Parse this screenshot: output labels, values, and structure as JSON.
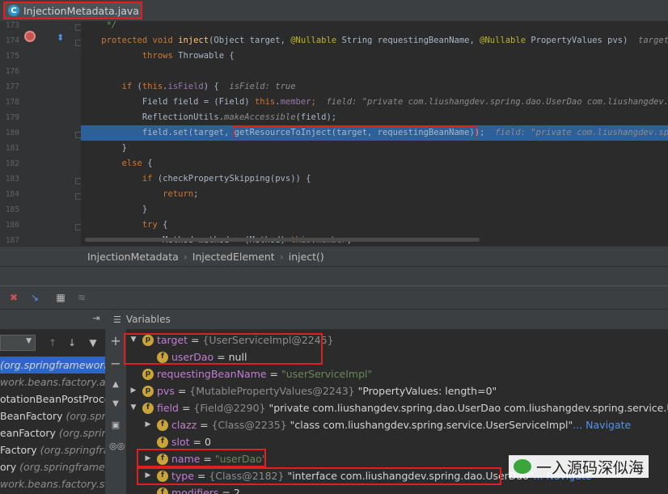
{
  "tab": {
    "label": "InjectionMetadata.java",
    "icon": "class-c-icon"
  },
  "editor": {
    "lines": [
      {
        "num": "173",
        "parts": [
          {
            "t": "     */",
            "c": "cm"
          }
        ]
      },
      {
        "num": "174",
        "parts": [
          {
            "t": "    ",
            "c": ""
          },
          {
            "t": "protected void ",
            "c": "kw"
          },
          {
            "t": "inject",
            "c": "mth"
          },
          {
            "t": "(Object target, ",
            "c": ""
          },
          {
            "t": "@Nullable ",
            "c": "an"
          },
          {
            "t": "String requestingBeanName, ",
            "c": ""
          },
          {
            "t": "@Nullable ",
            "c": "an"
          },
          {
            "t": "PropertyValues pvs)  ",
            "c": ""
          },
          {
            "t": "target: ",
            "c": "hint"
          }
        ]
      },
      {
        "num": "175",
        "parts": [
          {
            "t": "            ",
            "c": ""
          },
          {
            "t": "throws ",
            "c": "kw"
          },
          {
            "t": "Throwable {",
            "c": ""
          }
        ]
      },
      {
        "num": "176",
        "parts": []
      },
      {
        "num": "177",
        "parts": [
          {
            "t": "        ",
            "c": ""
          },
          {
            "t": "if ",
            "c": "kw"
          },
          {
            "t": "(",
            "c": ""
          },
          {
            "t": "this",
            "c": "kw"
          },
          {
            "t": ".",
            "c": ""
          },
          {
            "t": "isField",
            "c": "fld"
          },
          {
            "t": ") {  ",
            "c": ""
          },
          {
            "t": "isField: true",
            "c": "hint"
          }
        ]
      },
      {
        "num": "178",
        "parts": [
          {
            "t": "            Field field = (Field) ",
            "c": ""
          },
          {
            "t": "this",
            "c": "kw"
          },
          {
            "t": ".",
            "c": ""
          },
          {
            "t": "member",
            "c": "fld"
          },
          {
            "t": ";  ",
            "c": "kw"
          },
          {
            "t": "field: \"private com.liushangdev.spring.dao.UserDao com.liushangdev.s",
            "c": "hint"
          }
        ]
      },
      {
        "num": "179",
        "parts": [
          {
            "t": "            ReflectionUtils.",
            "c": ""
          },
          {
            "t": "makeAccessible",
            "c": "hint"
          },
          {
            "t": "(field);",
            "c": ""
          }
        ]
      },
      {
        "num": "180",
        "parts": [
          {
            "t": "            field.set(target, ",
            "c": ""
          },
          {
            "t": "getResourceToInject(target, requestingBeanName)",
            "c": "box"
          },
          {
            "t": ");  ",
            "c": ""
          },
          {
            "t": "field: \"private com.liushangdev.spr",
            "c": "hint"
          }
        ]
      },
      {
        "num": "181",
        "parts": [
          {
            "t": "        }",
            "c": ""
          }
        ]
      },
      {
        "num": "182",
        "parts": [
          {
            "t": "        ",
            "c": ""
          },
          {
            "t": "else ",
            "c": "kw"
          },
          {
            "t": "{",
            "c": ""
          }
        ]
      },
      {
        "num": "183",
        "parts": [
          {
            "t": "            ",
            "c": ""
          },
          {
            "t": "if ",
            "c": "kw"
          },
          {
            "t": "(checkPropertySkipping(pvs)) {",
            "c": ""
          }
        ]
      },
      {
        "num": "184",
        "parts": [
          {
            "t": "                ",
            "c": ""
          },
          {
            "t": "return",
            "c": "kw"
          },
          {
            "t": ";",
            "c": ""
          }
        ]
      },
      {
        "num": "185",
        "parts": [
          {
            "t": "            }",
            "c": ""
          }
        ]
      },
      {
        "num": "186",
        "parts": [
          {
            "t": "            ",
            "c": ""
          },
          {
            "t": "try ",
            "c": "kw"
          },
          {
            "t": "{",
            "c": ""
          }
        ]
      },
      {
        "num": "187",
        "parts": [
          {
            "t": "                Method method = (Method) ",
            "c": ""
          },
          {
            "t": "this",
            "c": "kw"
          },
          {
            "t": ".",
            "c": ""
          },
          {
            "t": "member",
            "c": "fld"
          },
          {
            "t": ";",
            "c": ""
          }
        ]
      }
    ],
    "highlight_line": "180"
  },
  "breadcrumb": [
    "InjectionMetadata",
    "InjectedElement",
    "inject()"
  ],
  "variables_title": "Variables",
  "frames": [
    {
      "main": "",
      "loc": "(org.springframework"
    },
    {
      "main": "",
      "loc": "work.beans.factory.ann"
    },
    {
      "main": "otationBeanPostProces",
      "loc": ""
    },
    {
      "main": "BeanFactory ",
      "loc": "(org.spring"
    },
    {
      "main": "eanFactory ",
      "loc": "(org.springfr"
    },
    {
      "main": "Factory ",
      "loc": "(org.springframe"
    },
    {
      "main": "ory ",
      "loc": "(org.springframework"
    },
    {
      "main": "",
      "loc": "work.beans.factory.suppo"
    }
  ],
  "variables": [
    {
      "indent": 0,
      "twisty": "▼",
      "icon": "p",
      "name": "target",
      "eq": " = ",
      "type": "{UserServiceImpl@2245}",
      "value": ""
    },
    {
      "indent": 1,
      "twisty": "",
      "icon": "f",
      "name": "userDao",
      "eq": " = ",
      "type": "",
      "value": "null",
      "plain": true
    },
    {
      "indent": 0,
      "twisty": "",
      "icon": "p",
      "name": "requestingBeanName",
      "eq": " = ",
      "type": "",
      "value": "\"userServiceImpl\"",
      "str": true
    },
    {
      "indent": 0,
      "twisty": "▶",
      "icon": "p",
      "name": "pvs",
      "eq": " = ",
      "type": "{MutablePropertyValues@2243}",
      "value": " \"PropertyValues: length=0\"",
      "plain": true
    },
    {
      "indent": 0,
      "twisty": "▼",
      "icon": "f",
      "name": "field",
      "eq": " = ",
      "type": "{Field@2290}",
      "value": " \"private com.liushangdev.spring.dao.UserDao com.liushangdev.spring.service.UserServi",
      "plain": true
    },
    {
      "indent": 1,
      "twisty": "▶",
      "icon": "f",
      "name": "clazz",
      "eq": " = ",
      "type": "{Class@2235}",
      "value": " \"class com.liushangdev.spring.service.UserServiceImpl\"",
      "plain": true,
      "nav": "... Navigate"
    },
    {
      "indent": 1,
      "twisty": "",
      "icon": "f",
      "name": "slot",
      "eq": " = ",
      "type": "",
      "value": "0",
      "plain": true
    },
    {
      "indent": 1,
      "twisty": "▶",
      "icon": "f",
      "name": "name",
      "eq": " = ",
      "type": "",
      "value": "\"userDao\"",
      "str": true
    },
    {
      "indent": 1,
      "twisty": "▶",
      "icon": "f",
      "name": "type",
      "eq": " = ",
      "type": "{Class@2182}",
      "value": " \"interface com.liushangdev.spring.dao.UserDao\"",
      "plain": true,
      "nav": "... Navigate"
    },
    {
      "indent": 1,
      "twisty": "",
      "icon": "f",
      "name": "modifiers",
      "eq": " = ",
      "type": "",
      "value": "2",
      "plain": true
    }
  ],
  "watermark": "一入源码深似海"
}
